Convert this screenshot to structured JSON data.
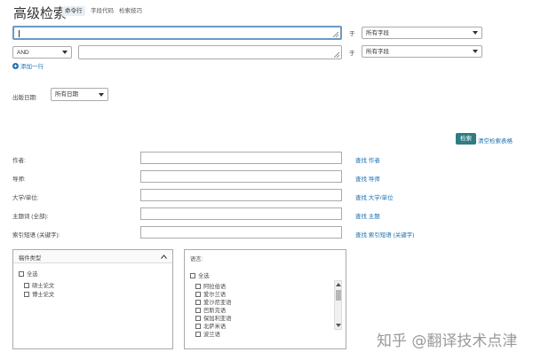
{
  "header": {
    "title": "高级检索",
    "tabs": [
      {
        "label": "命令行",
        "active": true
      },
      {
        "label": "字段代码",
        "active": false
      },
      {
        "label": "检索技巧",
        "active": false
      }
    ]
  },
  "query_rows": [
    {
      "value": "",
      "in_label": "于",
      "field": "所有字段"
    },
    {
      "operator": "AND",
      "value": "",
      "in_label": "于",
      "field": "所有字段"
    }
  ],
  "add_row_label": "添加一行",
  "date": {
    "label": "出版日期:",
    "value": "所有日期"
  },
  "actions": {
    "search": "检索",
    "clear": "清空检索表格"
  },
  "fields": [
    {
      "label": "作者:",
      "link": "查找 作者"
    },
    {
      "label": "导师:",
      "link": "查找 导师"
    },
    {
      "label": "大学/单位:",
      "link": "查找 大学/单位"
    },
    {
      "label": "主题词 (全部):",
      "link": "查找 主题"
    },
    {
      "label": "索引短语 (关键字):",
      "link": "查找 索引短语 (关键字)"
    }
  ],
  "doc_type_panel": {
    "title": "稿件类型",
    "items": [
      "全选",
      "硕士论文",
      "博士论文"
    ]
  },
  "language_panel": {
    "title": "语言:",
    "items": [
      "全选",
      "阿拉伯语",
      "爱尔兰语",
      "爱沙尼亚语",
      "巴斯克语",
      "保加利亚语",
      "北萨米语",
      "波兰语"
    ]
  },
  "watermark": "知乎 @翻译技术点津",
  "colors": {
    "accent": "#2f7c82",
    "link": "#1a6fb0",
    "focus": "#6d99c4"
  }
}
